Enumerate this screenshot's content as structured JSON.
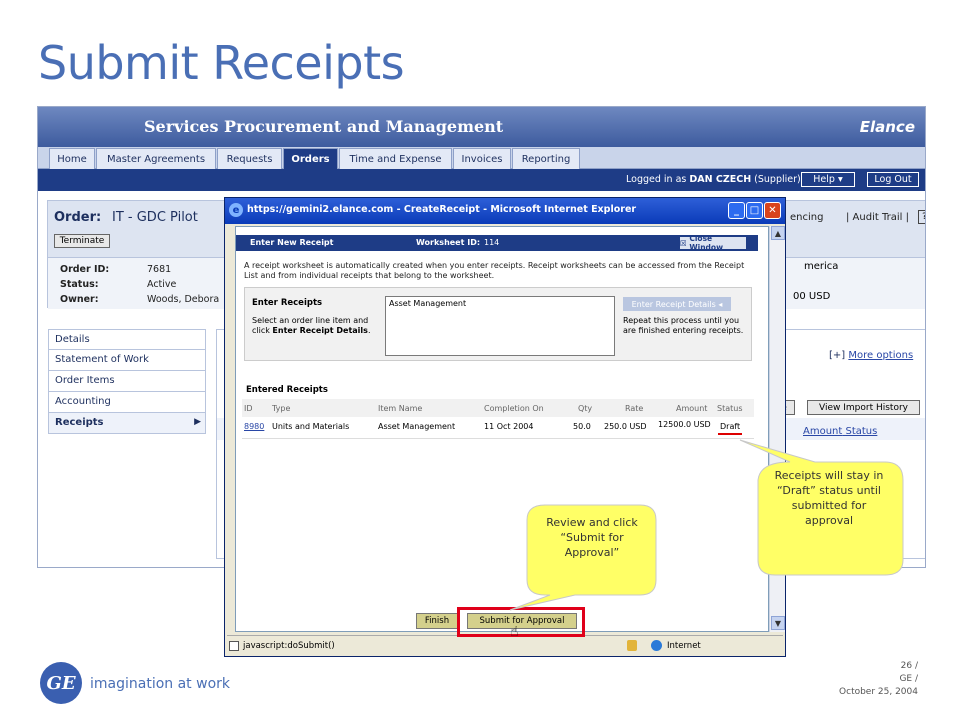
{
  "slide": {
    "title": "Submit Receipts",
    "tagline": "imagination at work",
    "page_number": "26 /",
    "company": "GE /",
    "date": "October 25, 2004",
    "logo_text": "GE"
  },
  "app": {
    "title": "Services Procurement and Management",
    "brand": "Elance",
    "nav": [
      "Home",
      "Master Agreements",
      "Requests",
      "Orders",
      "Time and Expense",
      "Invoices",
      "Reporting"
    ],
    "active_tab": "Orders",
    "logged_in_prefix": "Logged in as ",
    "logged_in_user": "DAN CZECH",
    "logged_in_role": " (Supplier)",
    "help_label": "Help",
    "logout_label": "Log Out",
    "order_label": "Order:",
    "order_name": "IT - GDC Pilot",
    "terminate_label": "Terminate",
    "fencing_label": "encing",
    "audit_trail_label": "| Audit Trail |",
    "help_icon": "?",
    "order_id_label": "Order ID:",
    "order_id": "7681",
    "status_label": "Status:",
    "status": "Active",
    "owner_label": "Owner:",
    "owner": "Woods, Debora",
    "region_fragment": "merica",
    "usd_fragment": "00 USD",
    "left_menu": [
      "Details",
      "Statement of Work",
      "Order Items",
      "Accounting",
      "Receipts"
    ],
    "active_menu": "Receipts",
    "more_options_prefix": "[+] ",
    "more_options": "More options",
    "import_btn_fragment": "e",
    "view_import_history": "View Import History",
    "amount_col": "Amount",
    "status_col": "Status"
  },
  "popup": {
    "title": "https://gemini2.elance.com - CreateReceipt - Microsoft Internet Explorer",
    "header_title": "Enter New Receipt",
    "worksheet_label": "Worksheet ID:",
    "worksheet_id": "114",
    "close_window": "Close Window",
    "intro": "A receipt worksheet is automatically created when you enter receipts. Receipt worksheets can be accessed from the Receipt List and from individual receipts that belong to the worksheet.",
    "enter_receipts_title": "Enter Receipts",
    "enter_receipts_instr_1": "Select an order line item and click ",
    "enter_receipts_instr_bold": "Enter Receipt Details",
    "enter_receipts_instr_2": ".",
    "line_item": "Asset Management",
    "enter_details_btn": "Enter Receipt Details",
    "repeat_text": "Repeat this process until you are finished entering receipts.",
    "entered_title": "Entered Receipts",
    "columns": [
      "ID",
      "Type",
      "Item Name",
      "Completion On",
      "Qty",
      "Rate",
      "Amount",
      "Status"
    ],
    "rows": [
      {
        "id": "8980",
        "type": "Units and Materials",
        "item": "Asset Management",
        "completion": "11 Oct 2004",
        "qty": "50.0",
        "rate": "250.0 USD",
        "amount": "12500.0 USD",
        "status": "Draft"
      }
    ],
    "finish_label": "Finish",
    "submit_label": "Submit for Approval",
    "status_bar_text": "javascript:doSubmit()",
    "zone": "Internet"
  },
  "callouts": {
    "draft_note": "Receipts will stay in “Draft” status until submitted for approval",
    "submit_note": "Review and click “Submit for Approval”"
  },
  "colors": {
    "title_blue": "#4a6fb5",
    "nav_dark": "#1e3c86",
    "callout_fill": "#ffff66",
    "highlight_red": "#e0001a"
  }
}
